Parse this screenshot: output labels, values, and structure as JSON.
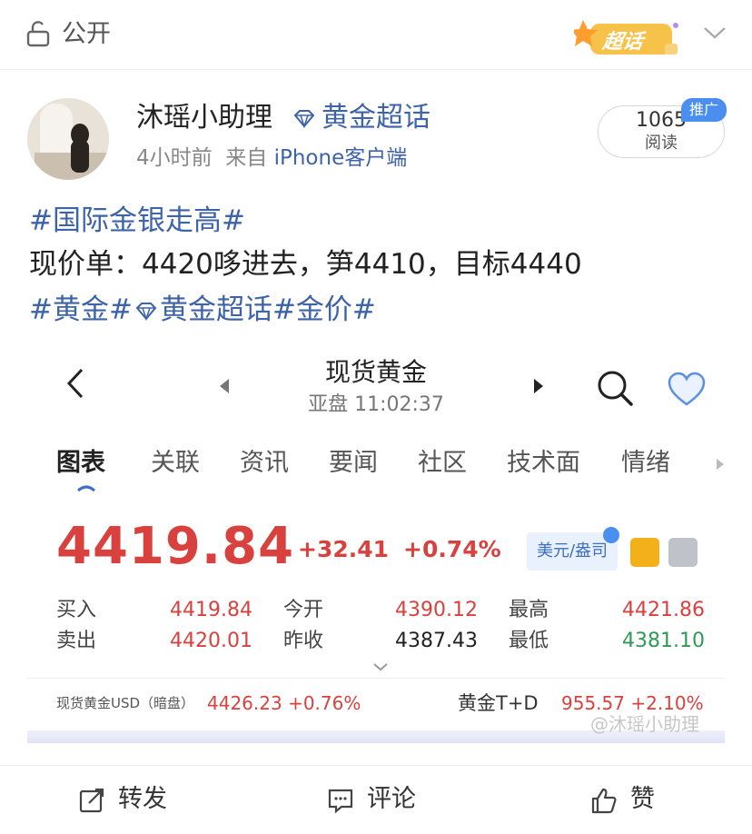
{
  "topbar": {
    "visibility_label": "公开",
    "super_topic_badge": "超话",
    "icons": [
      "lock-icon",
      "chevron-down-icon"
    ]
  },
  "post": {
    "author": "沐瑶小助理",
    "topic": "黄金超话",
    "time": "4小时前",
    "source_prefix": "来自",
    "source": "iPhone客户端",
    "read_count": "1065",
    "read_label": "阅读",
    "promo_badge": "推广",
    "hashtag_line": "#国际金银走高#",
    "body_line": "现价单：4420哆进去，笋4410，目标4440",
    "tags_line_a": "#黄金#",
    "tags_line_b": "黄金超话#金价#"
  },
  "embed": {
    "title": "现货黄金",
    "subtitle": "亚盘 11:02:37",
    "tabs": [
      "图表",
      "关联",
      "资讯",
      "要闻",
      "社区",
      "技术面",
      "情绪"
    ],
    "price": "4419.84",
    "change": "+32.41",
    "change_pct": "+0.74%",
    "unit_badge": "美元/盎司",
    "quotes": [
      {
        "label": "买入",
        "value": "4419.84",
        "color": "red"
      },
      {
        "label": "今开",
        "value": "4390.12",
        "color": "red"
      },
      {
        "label": "最高",
        "value": "4421.86",
        "color": "red"
      },
      {
        "label": "卖出",
        "value": "4420.01",
        "color": "red"
      },
      {
        "label": "昨收",
        "value": "4387.43",
        "color": "dark"
      },
      {
        "label": "最低",
        "value": "4381.10",
        "color": "green"
      }
    ],
    "footer_left_label": "现货黄金USD（暗盘）",
    "footer_left_value": "4426.23  +0.76%",
    "footer_right_label": "黄金T+D",
    "footer_right_value": "955.57  +2.10%",
    "watermark": "@沐瑶小助理"
  },
  "actions": {
    "repost": "转发",
    "comment": "评论",
    "like": "赞"
  },
  "colors": {
    "link_blue": "#3d63a8",
    "price_red": "#d9413e",
    "down_green": "#2e9b54"
  }
}
